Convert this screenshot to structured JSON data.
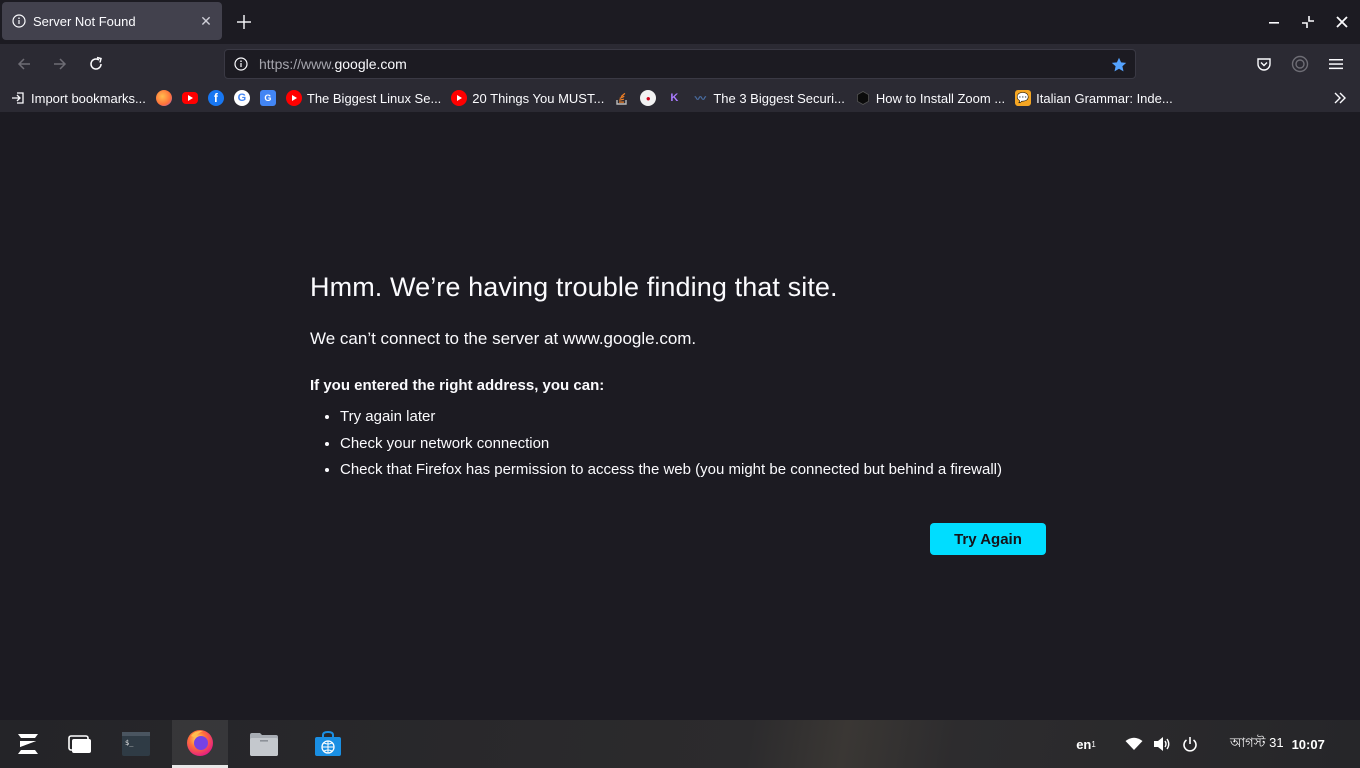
{
  "tab": {
    "title": "Server Not Found",
    "close": "✕"
  },
  "toolbar": {
    "new_tab": "+"
  },
  "window": {
    "minimize": "–",
    "restore": "⤡",
    "close": "✕"
  },
  "urlbar": {
    "prefix": "https://www.",
    "domain": "google.com"
  },
  "bookmarks": [
    {
      "label": "Import bookmarks...",
      "icon": "import-icon"
    },
    {
      "label": "",
      "icon": "firefox-icon"
    },
    {
      "label": "",
      "icon": "youtube-icon"
    },
    {
      "label": "",
      "icon": "facebook-icon"
    },
    {
      "label": "",
      "icon": "google-icon"
    },
    {
      "label": "",
      "icon": "google-translate-icon"
    },
    {
      "label": "The Biggest Linux Se...",
      "icon": "youtube-icon"
    },
    {
      "label": "20 Things You MUST...",
      "icon": "youtube-icon"
    },
    {
      "label": "",
      "icon": "stackoverflow-icon"
    },
    {
      "label": "",
      "icon": "site-icon"
    },
    {
      "label": "",
      "icon": "kotlin-icon"
    },
    {
      "label": "The 3 Biggest Securi...",
      "icon": "site-icon"
    },
    {
      "label": "How to Install Zoom ...",
      "icon": "hexagon-icon"
    },
    {
      "label": "Italian Grammar: Inde...",
      "icon": "chat-icon"
    }
  ],
  "error": {
    "title": "Hmm. We’re having trouble finding that site.",
    "subtitle": "We can’t connect to the server at www.google.com.",
    "hint": "If you entered the right address, you can:",
    "suggestions": [
      "Try again later",
      "Check your network connection",
      "Check that Firefox has permission to access the web (you might be connected but behind a firewall)"
    ],
    "button": "Try Again"
  },
  "taskbar": {
    "lang": "en",
    "lang_sub": "1",
    "date": "আগস্ট 31",
    "time": "10:07"
  },
  "colors": {
    "accent": "#00ddff",
    "background": "#1c1b22",
    "toolbar": "#2b2a33",
    "tab_active": "#42414d"
  }
}
